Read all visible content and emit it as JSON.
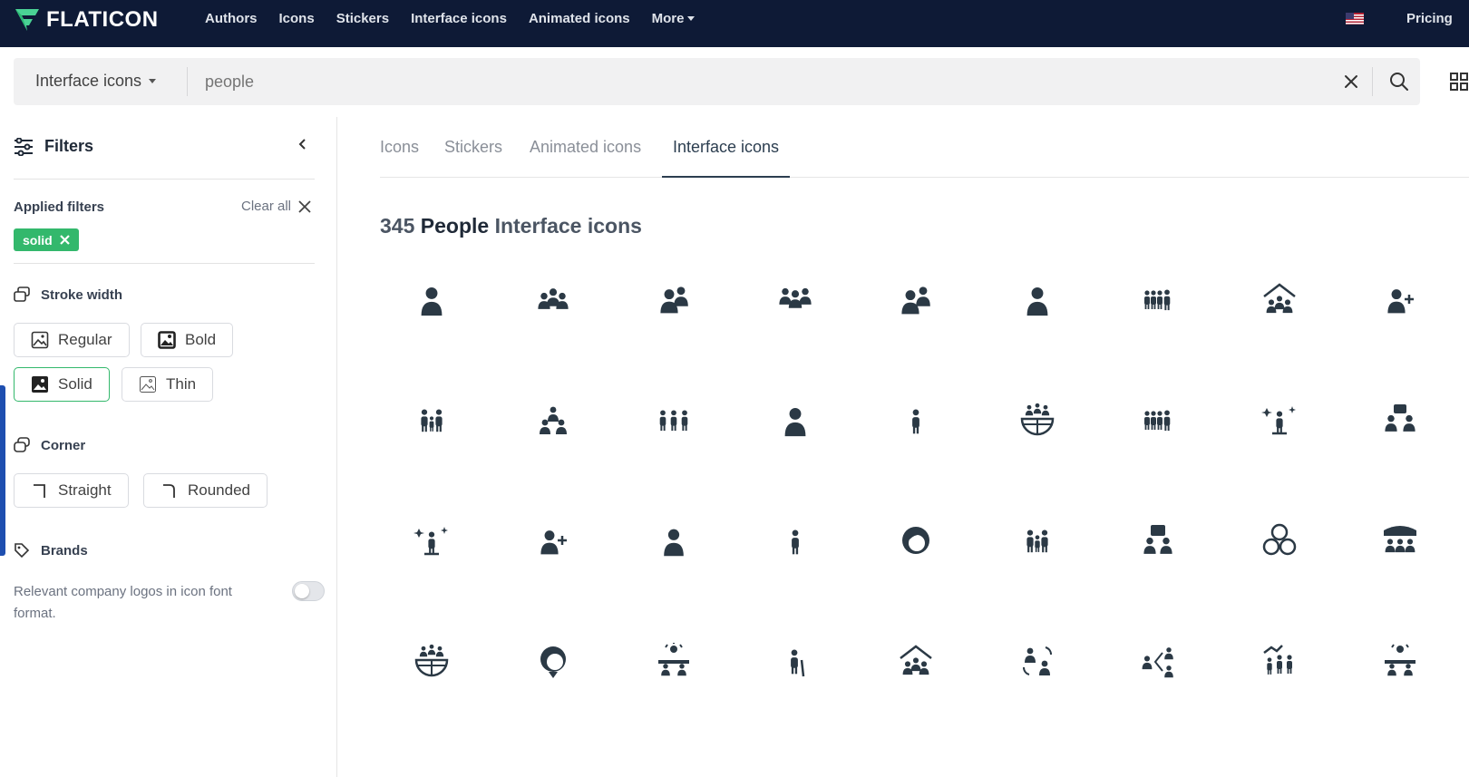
{
  "brand": {
    "name": "FLATICON",
    "accent": "#33b86c",
    "nav_bg": "#0e1a36"
  },
  "nav": {
    "items": [
      {
        "label": "Authors"
      },
      {
        "label": "Icons"
      },
      {
        "label": "Stickers"
      },
      {
        "label": "Interface icons"
      },
      {
        "label": "Animated icons"
      },
      {
        "label": "More"
      }
    ],
    "pricing": "Pricing",
    "flag_icon": "us-flag-icon"
  },
  "search": {
    "type_label": "Interface icons",
    "value": "people",
    "placeholder": ""
  },
  "sidebar": {
    "title": "Filters",
    "applied_label": "Applied filters",
    "clear_all": "Clear all",
    "chip": "solid",
    "stroke": {
      "label": "Stroke width",
      "options": [
        {
          "label": "Regular"
        },
        {
          "label": "Bold"
        },
        {
          "label": "Solid",
          "selected": true
        },
        {
          "label": "Thin"
        }
      ]
    },
    "corner": {
      "label": "Corner",
      "options": [
        {
          "label": "Straight"
        },
        {
          "label": "Rounded"
        }
      ]
    },
    "brands": {
      "label": "Brands",
      "description": "Relevant company logos in icon font format.",
      "enabled": false
    }
  },
  "tabs": [
    {
      "label": "Icons"
    },
    {
      "label": "Stickers"
    },
    {
      "label": "Animated icons"
    },
    {
      "label": "Interface icons",
      "active": true
    }
  ],
  "results": {
    "count": "345",
    "keyword": "People",
    "suffix": "Interface icons"
  },
  "icons": [
    "user-icon",
    "users-icon",
    "user-group-icon",
    "people-group-icon",
    "user-duo-icon",
    "person-icon",
    "queue-icon",
    "house-people-icon",
    "user-add-icon",
    "family-icon",
    "team-pyramid-icon",
    "people-row-icon",
    "user-tie-icon",
    "child-icon",
    "globe-people-icon",
    "queue-alt-icon",
    "person-sparkle-icon",
    "meeting-icon",
    "person-sparkle-alt-icon",
    "add-user-icon",
    "user-simple-icon",
    "standing-person-icon",
    "woman-icon",
    "group-hug-icon",
    "leader-icon",
    "people-network-icon",
    "audience-icon",
    "globe-network-icon",
    "boy-face-icon",
    "presentation-icon",
    "elderly-icon",
    "home-community-icon",
    "user-exchange-icon",
    "share-people-icon",
    "growth-team-icon",
    "conference-icon"
  ]
}
